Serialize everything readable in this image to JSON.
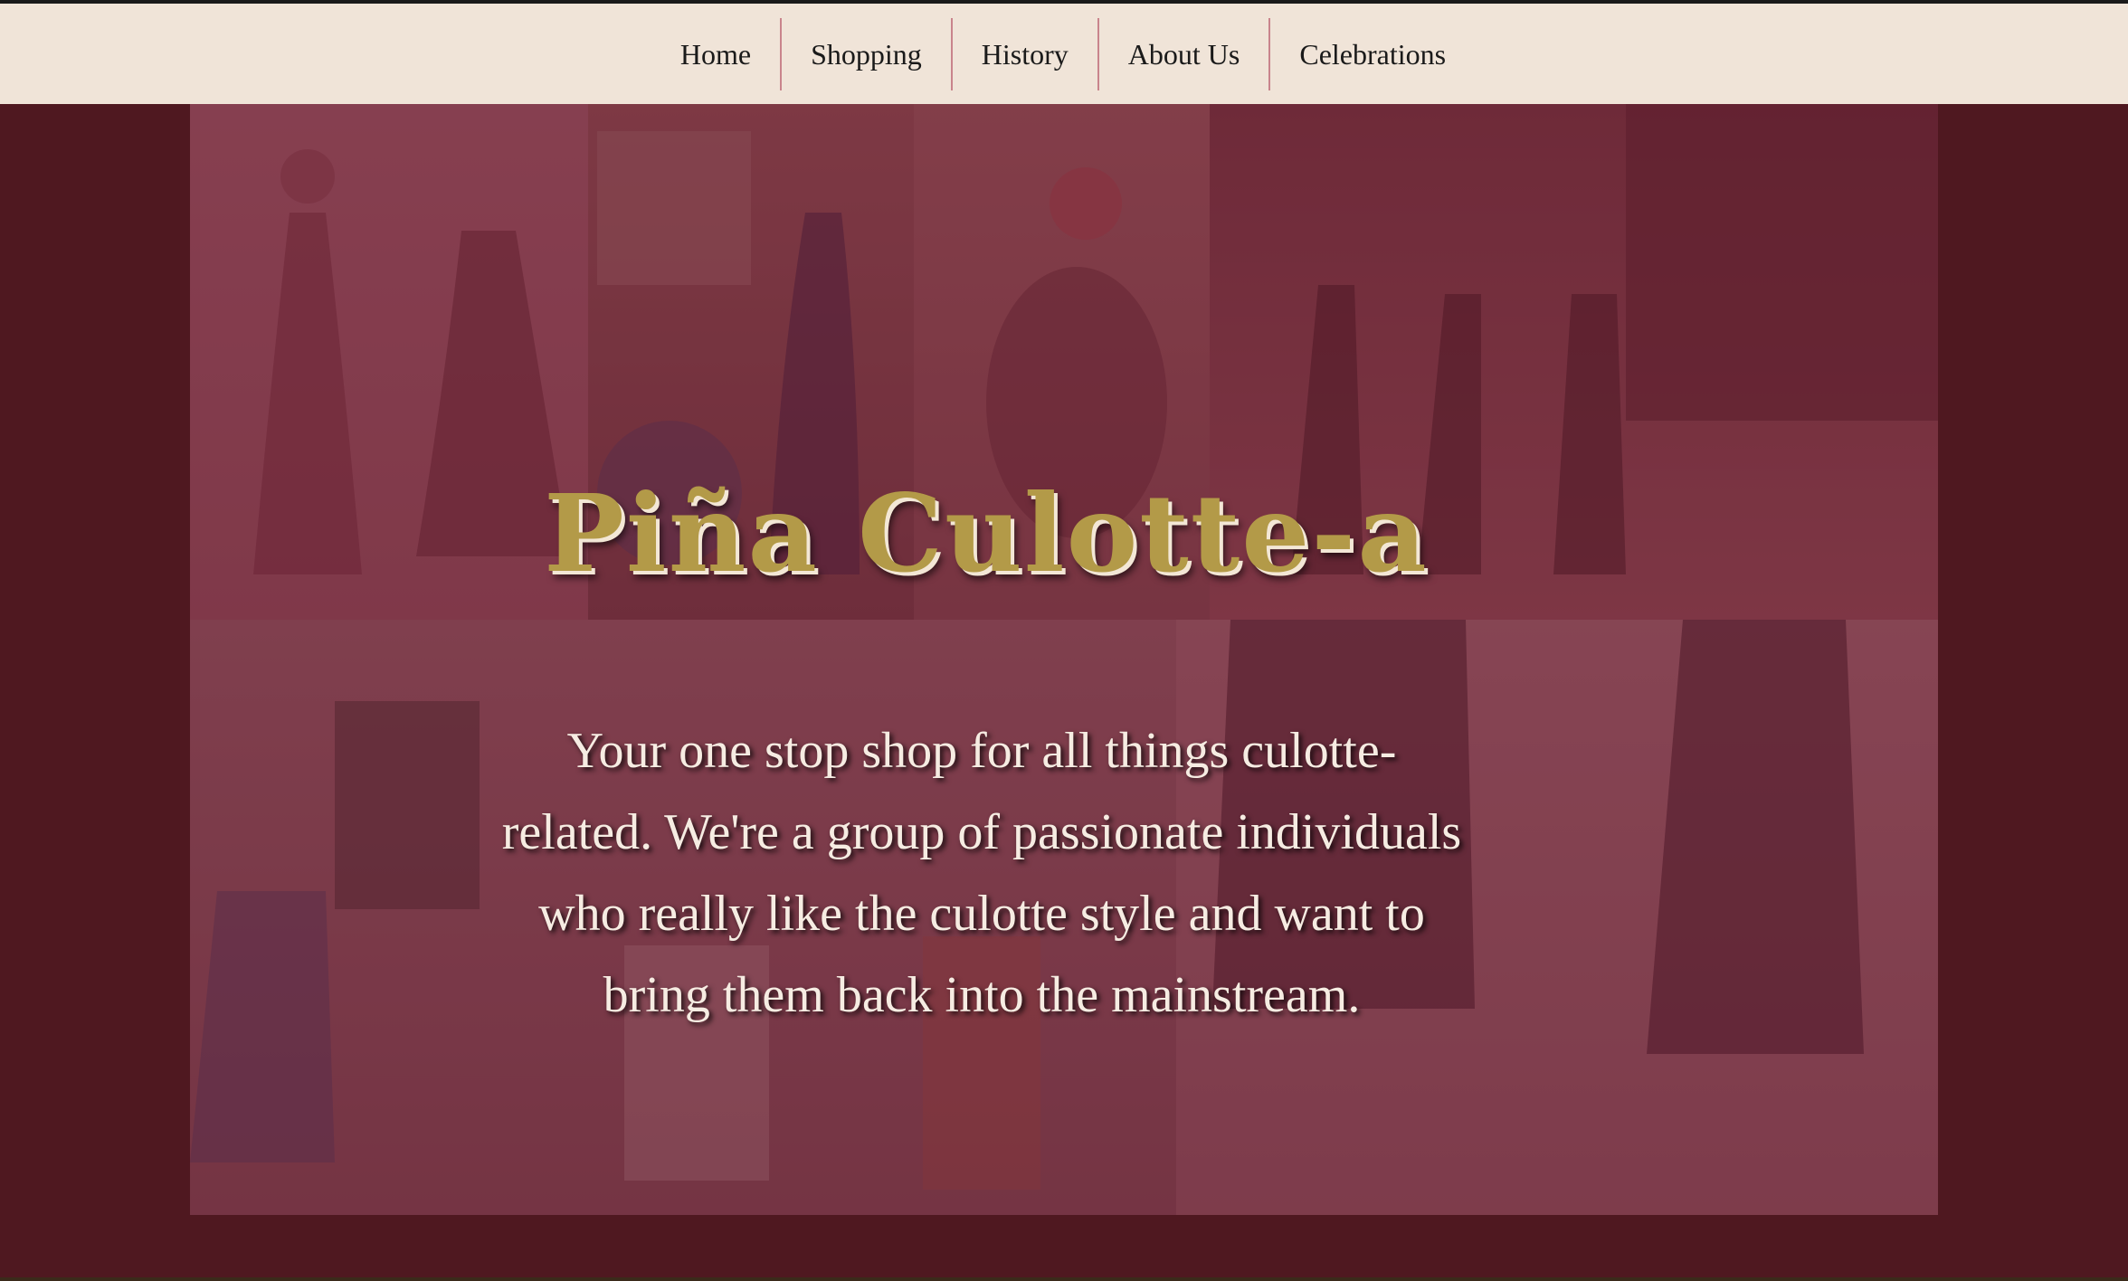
{
  "nav": {
    "items": [
      {
        "label": "Home"
      },
      {
        "label": "Shopping"
      },
      {
        "label": "History"
      },
      {
        "label": "About Us"
      },
      {
        "label": "Celebrations"
      }
    ]
  },
  "hero": {
    "title": "Piña Culotte-a",
    "text": "Your one stop shop for all things culotte-related. We're a group of passionate individuals who really like the culotte style and want to bring them back into the mainstream."
  },
  "colors": {
    "page_background": "#4f1820",
    "nav_background": "#f0e4d8",
    "nav_separator": "#c9848c",
    "title_gold": "#b39a48",
    "text_light": "#f6ece2"
  }
}
